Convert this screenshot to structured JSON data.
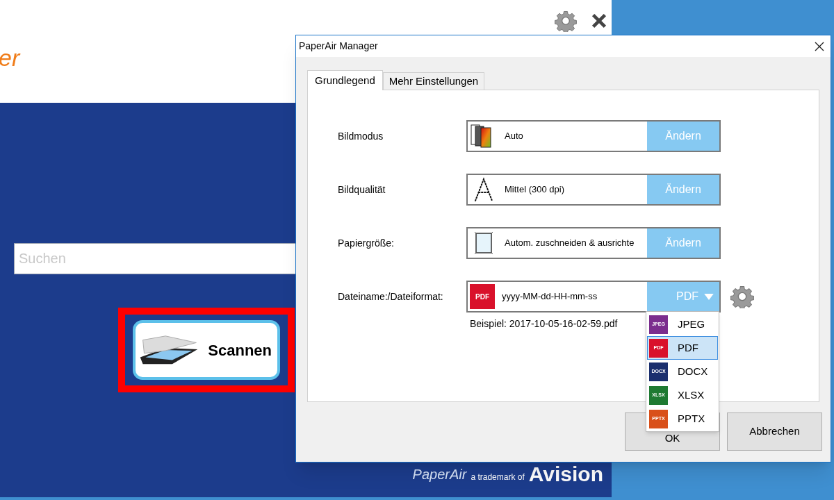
{
  "app": {
    "logo_text": "er",
    "search": {
      "placeholder": "Suchen"
    },
    "scan_button": {
      "label": "Scannen",
      "highlighted": true
    },
    "footer_logo": {
      "brand": "PaperAir",
      "tagline": "a trademark of",
      "company": "Avision"
    }
  },
  "dialog": {
    "title": "PaperAir Manager",
    "tabs": [
      {
        "label": "Grundlegend",
        "selected": true
      },
      {
        "label": "Mehr Einstellungen",
        "selected": false
      }
    ],
    "settings": [
      {
        "kind": "mode",
        "label": "Bildmodus",
        "value": "Auto",
        "button": "Ändern"
      },
      {
        "kind": "quality",
        "label": "Bildqualität",
        "value": "Mittel (300 dpi)",
        "button": "Ändern"
      },
      {
        "kind": "paper",
        "label": "Papiergröße:",
        "value": "Autom. zuschneiden & ausrichte",
        "button": "Ändern"
      },
      {
        "kind": "format",
        "label": "Dateiname:/Dateiformat:",
        "badge": "PDF",
        "value": "yyyy-MM-dd-HH-mm-ss",
        "button": "PDF"
      }
    ],
    "example": "Beispiel: 2017-10-05-16-02-59.pdf",
    "format_menu": {
      "open": true,
      "items": [
        {
          "badge": "JPEG",
          "label": "JPEG",
          "color": "#7b2d8e",
          "selected": false
        },
        {
          "badge": "PDF",
          "label": "PDF",
          "color": "#d9112b",
          "selected": true
        },
        {
          "badge": "DOCX",
          "label": "DOCX",
          "color": "#1b2f6e",
          "selected": false
        },
        {
          "badge": "XLSX",
          "label": "XLSX",
          "color": "#1f7a32",
          "selected": false
        },
        {
          "badge": "PPTX",
          "label": "PPTX",
          "color": "#d9501a",
          "selected": false
        }
      ]
    },
    "buttons": [
      {
        "label": "OK"
      },
      {
        "label": "Abbrechen"
      }
    ]
  }
}
